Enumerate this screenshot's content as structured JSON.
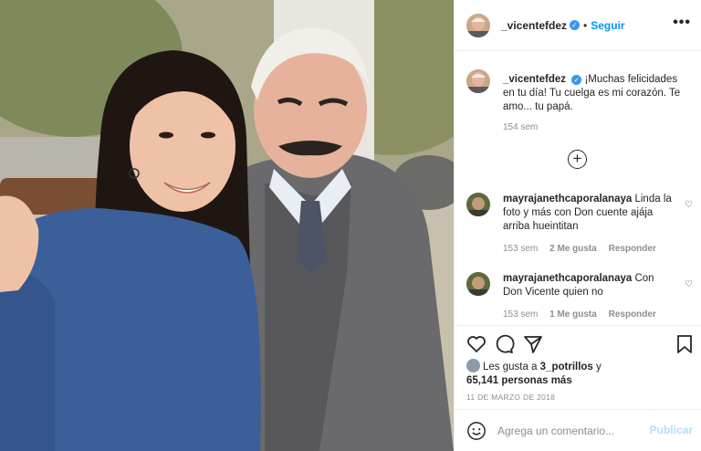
{
  "post": {
    "author": "_vicentefdez",
    "follow_label": "Seguir",
    "separator": "•",
    "more_label": "•••",
    "verified_mark": "✓"
  },
  "caption": {
    "username": "_vicentefdez",
    "text": "¡Muchas felicidades en tu día! Tu cuelga es mi corazón. Te amo... tu papá.",
    "time": "154 sem"
  },
  "load_more_icon": "plus-circle-icon",
  "comments": [
    {
      "username": "mayrajanethcaporalanaya",
      "text": "Linda la foto y más con Don cuente ajája arriba hueintitan",
      "time": "153 sem",
      "likes": "2 Me gusta",
      "reply": "Responder"
    },
    {
      "username": "mayrajanethcaporalanaya",
      "text": "Con Don Vicente quien no",
      "time": "153 sem",
      "likes": "1 Me gusta",
      "reply": "Responder"
    }
  ],
  "actions": {
    "icons": [
      "heart-icon",
      "comment-icon",
      "share-icon",
      "bookmark-icon"
    ]
  },
  "likes": {
    "prefix": "Les gusta a",
    "first_user": "3_potrillos",
    "connector": "y",
    "count": "65,141 personas más"
  },
  "date": "11 DE MARZO DE 2018",
  "comment_box": {
    "placeholder": "Agrega un comentario...",
    "publish_label": "Publicar"
  },
  "colors": {
    "accent": "#0095f6",
    "publish_disabled": "#b2dffc",
    "muted": "#8e8e8e",
    "text": "#262626"
  }
}
